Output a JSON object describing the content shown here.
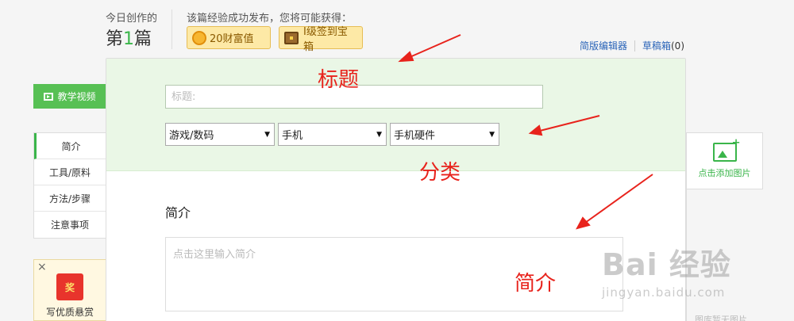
{
  "header": {
    "today_label": "今日创作的",
    "count_prefix": "第",
    "count_number": "1",
    "count_suffix": "篇",
    "publish_message": "该篇经验成功发布，您将可能获得：",
    "rewards": [
      {
        "label": "20财富值",
        "icon": "coin-icon"
      },
      {
        "label": "I级签到宝箱",
        "icon": "treasure-chest-icon"
      }
    ],
    "links": {
      "simple_editor": "简版编辑器",
      "drafts": "草稿箱",
      "drafts_count": "(0)"
    }
  },
  "sidebar": {
    "video_button": "教学视频",
    "nav_items": [
      {
        "label": "简介",
        "active": true
      },
      {
        "label": "工具/原料",
        "active": false
      },
      {
        "label": "方法/步骤",
        "active": false
      },
      {
        "label": "注意事项",
        "active": false
      }
    ],
    "promo": {
      "close": "×",
      "badge": "奖",
      "text": "写优质悬赏"
    }
  },
  "editor": {
    "title_placeholder": "标题:",
    "categories": [
      "游戏/数码",
      "手机",
      "手机硬件"
    ],
    "intro_heading": "简介",
    "intro_placeholder": "点击这里输入简介"
  },
  "right_panel": {
    "add_image_label": "点击添加图片",
    "bottom_text": "图库暂无图片"
  },
  "annotations": [
    "标题",
    "分类",
    "简介"
  ],
  "watermark": {
    "main": "Bai 经验",
    "url": "jingyan.baidu.com"
  },
  "colors": {
    "accent_green": "#3ab54a",
    "annotation_red": "#e8231c",
    "link_blue": "#2a64b8",
    "reward_bg": "#fde9a6"
  }
}
